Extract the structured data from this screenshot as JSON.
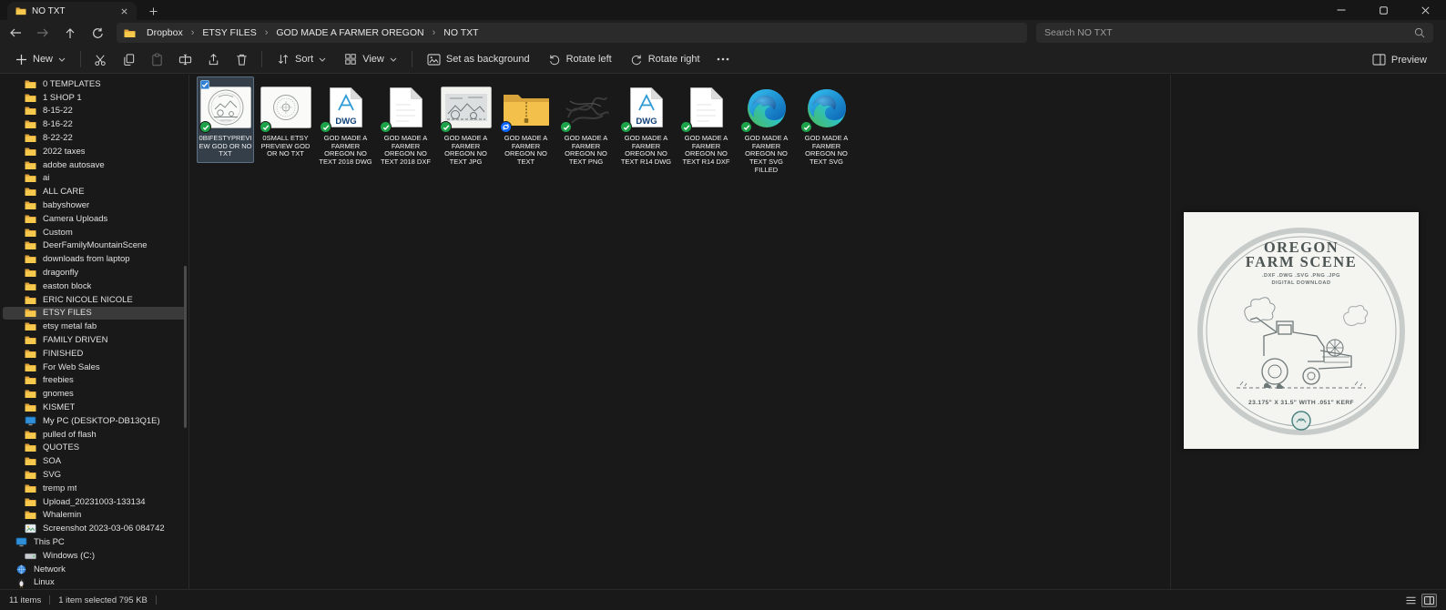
{
  "window": {
    "tab_title": "NO TXT"
  },
  "address_bar": {
    "breadcrumbs": [
      "Dropbox",
      "ETSY FILES",
      "GOD MADE A FARMER OREGON",
      "NO TXT"
    ],
    "separator": "›",
    "search_placeholder": "Search NO TXT"
  },
  "toolbar": {
    "new_label": "New",
    "sort_label": "Sort",
    "view_label": "View",
    "set_background_label": "Set as background",
    "rotate_left_label": "Rotate left",
    "rotate_right_label": "Rotate right",
    "preview_label": "Preview"
  },
  "sidebar": {
    "items": [
      {
        "label": "0 TEMPLATES",
        "icon": "folder"
      },
      {
        "label": "1 SHOP 1",
        "icon": "folder"
      },
      {
        "label": "8-15-22",
        "icon": "folder"
      },
      {
        "label": "8-16-22",
        "icon": "folder"
      },
      {
        "label": "8-22-22",
        "icon": "folder"
      },
      {
        "label": "2022 taxes",
        "icon": "folder"
      },
      {
        "label": "adobe autosave",
        "icon": "folder"
      },
      {
        "label": "ai",
        "icon": "folder"
      },
      {
        "label": "ALL CARE",
        "icon": "folder"
      },
      {
        "label": "babyshower",
        "icon": "folder"
      },
      {
        "label": "Camera Uploads",
        "icon": "folder"
      },
      {
        "label": "Custom",
        "icon": "folder"
      },
      {
        "label": "DeerFamilyMountainScene",
        "icon": "folder"
      },
      {
        "label": "downloads from laptop",
        "icon": "folder"
      },
      {
        "label": "dragonfly",
        "icon": "folder"
      },
      {
        "label": "easton block",
        "icon": "folder"
      },
      {
        "label": "ERIC NICOLE NICOLE",
        "icon": "folder"
      },
      {
        "label": "ETSY FILES",
        "icon": "folder",
        "selected": true
      },
      {
        "label": "etsy metal fab",
        "icon": "folder"
      },
      {
        "label": "FAMILY DRIVEN",
        "icon": "folder"
      },
      {
        "label": "FINISHED",
        "icon": "folder"
      },
      {
        "label": "For Web Sales",
        "icon": "folder"
      },
      {
        "label": "freebies",
        "icon": "folder"
      },
      {
        "label": "gnomes",
        "icon": "folder"
      },
      {
        "label": "KISMET",
        "icon": "folder"
      },
      {
        "label": "My PC (DESKTOP-DB13Q1E)",
        "icon": "monitor"
      },
      {
        "label": "pulled of flash",
        "icon": "folder"
      },
      {
        "label": "QUOTES",
        "icon": "folder"
      },
      {
        "label": "SOA",
        "icon": "folder"
      },
      {
        "label": "SVG",
        "icon": "folder"
      },
      {
        "label": "tremp mt",
        "icon": "folder"
      },
      {
        "label": "Upload_20231003-133134",
        "icon": "folder"
      },
      {
        "label": "Whalemin",
        "icon": "folder"
      },
      {
        "label": "Screenshot 2023-03-06 084742",
        "icon": "image"
      },
      {
        "label": "This PC",
        "icon": "monitor",
        "indent": 0
      },
      {
        "label": "Windows (C:)",
        "icon": "drive"
      },
      {
        "label": "Network",
        "icon": "globe",
        "indent": 0
      },
      {
        "label": "Linux",
        "icon": "penguin",
        "indent": 0
      }
    ]
  },
  "files": {
    "items": [
      {
        "name": "0BIFESTYPREVIEW GOD OR NO TXT",
        "type": "thumb1",
        "badge": "check",
        "selected": true
      },
      {
        "name": "0SMALL ETSY PREVIEW GOD OR NO TXT",
        "type": "thumb2",
        "badge": "check"
      },
      {
        "name": "GOD MADE A FARMER OREGON NO TEXT 2018 DWG",
        "type": "dwg",
        "badge": "check"
      },
      {
        "name": "GOD MADE A FARMER OREGON NO TEXT 2018 DXF",
        "type": "dxf",
        "badge": "check"
      },
      {
        "name": "GOD MADE A FARMER OREGON NO TEXT JPG",
        "type": "scene",
        "badge": "check"
      },
      {
        "name": "GOD MADE A FARMER OREGON NO TEXT",
        "type": "zip",
        "badge": "sync"
      },
      {
        "name": "GOD MADE A FARMER OREGON NO TEXT PNG",
        "type": "scribble",
        "badge": "check"
      },
      {
        "name": "GOD MADE A FARMER OREGON NO TEXT R14 DWG",
        "type": "dwg",
        "badge": "check"
      },
      {
        "name": "GOD MADE A FARMER OREGON NO TEXT R14 DXF",
        "type": "dxf",
        "badge": "check"
      },
      {
        "name": "GOD MADE A FARMER OREGON NO TEXT SVG FILLED",
        "type": "edge",
        "badge": "check"
      },
      {
        "name": "GOD MADE A FARMER OREGON NO TEXT SVG",
        "type": "edge",
        "badge": "check"
      }
    ]
  },
  "preview": {
    "title_line1": "OREGON",
    "title_line2": "FARM SCENE",
    "formats_line": ".DXF .DWG .SVG .PNG .JPG",
    "download_line": "DIGITAL DOWNLOAD",
    "dimensions_line": "23.175\" X 31.5\" WITH .051\" KERF"
  },
  "status_bar": {
    "items_count": "11 items",
    "selection_summary": "1 item selected 795 KB"
  },
  "colors": {
    "accent_blue": "#2f7fd6",
    "dropbox_check_green": "#1fa34a",
    "sync_blue": "#0a66ff",
    "folder_yellow": "#f3c04b"
  }
}
